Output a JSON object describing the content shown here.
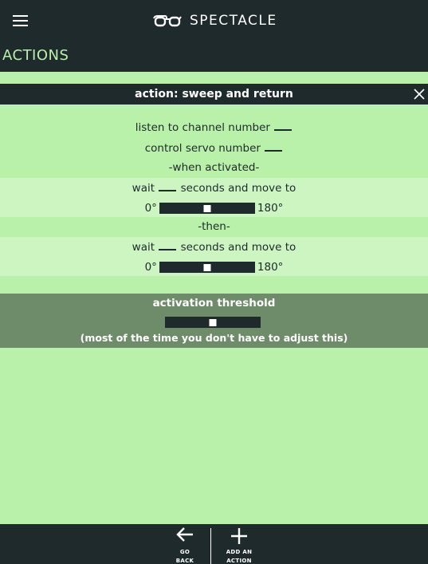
{
  "app": {
    "brand_name": "SPECTACLE"
  },
  "page": {
    "section_title": "ACTIONS"
  },
  "action": {
    "title": "action: sweep and return",
    "listen_label": "listen to channel number",
    "servo_label": "control servo number",
    "when_activated": "-when activated-",
    "then_label": "-then-",
    "wait_label": "wait",
    "seconds_label": "seconds and move to",
    "min_angle": "0°",
    "max_angle": "180°",
    "first_move_level": 0.5,
    "second_move_level": 0.5
  },
  "threshold": {
    "title": "activation threshold",
    "note": "(most of the time you don't have to adjust this)",
    "level": 0.5
  },
  "nav": {
    "back_line1": "GO",
    "back_line2": "BACK",
    "add_line1": "ADD AN",
    "add_line2": "ACTION"
  }
}
